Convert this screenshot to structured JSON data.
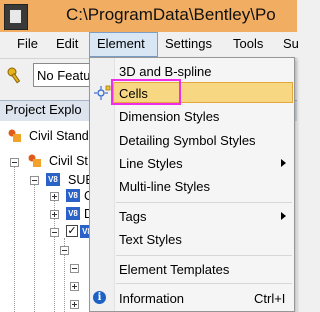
{
  "window": {
    "title": "C:\\ProgramData\\Bentley\\Po"
  },
  "menubar": [
    {
      "key": "file",
      "label": "File"
    },
    {
      "key": "edit",
      "label": "Edit"
    },
    {
      "key": "element",
      "label": "Element"
    },
    {
      "key": "settings",
      "label": "Settings"
    },
    {
      "key": "tools",
      "label": "Tools"
    },
    {
      "key": "su",
      "label": "Su"
    }
  ],
  "toolbar": {
    "feature_combo_value": "No Featu"
  },
  "explorer": {
    "title": "Project Explo",
    "nodes": [
      {
        "label": "Civil Stand"
      },
      {
        "label": "Civil St"
      },
      {
        "label": "SUE"
      },
      {
        "label": "C"
      },
      {
        "label": "D"
      },
      {
        "label": ""
      }
    ]
  },
  "element_menu": {
    "items": [
      {
        "key": "3d-and-bspline",
        "label": "3D and B-spline",
        "submenu": false
      },
      {
        "key": "cells",
        "label": "Cells",
        "submenu": false,
        "highlighted": true
      },
      {
        "key": "dimension-styles",
        "label": "Dimension Styles",
        "submenu": false
      },
      {
        "key": "detailing-symbol-styles",
        "label": "Detailing Symbol Styles",
        "submenu": false
      },
      {
        "key": "line-styles",
        "label": "Line Styles",
        "submenu": true
      },
      {
        "key": "multiline-styles",
        "label": "Multi-line Styles",
        "submenu": false
      },
      {
        "key": "tags",
        "label": "Tags",
        "submenu": true
      },
      {
        "key": "text-styles",
        "label": "Text Styles",
        "submenu": false
      },
      {
        "key": "element-templates",
        "label": "Element Templates",
        "submenu": false
      },
      {
        "key": "information",
        "label": "Information",
        "submenu": false,
        "shortcut": "Ctrl+I"
      }
    ]
  },
  "colors": {
    "titlebar": "#f1ad62",
    "highlight": "#f7d782",
    "annotation_box": "#ef2ee8",
    "v8_badge": "#2a62c8"
  },
  "icons": {
    "cells": "cells-icon",
    "information": "info-icon",
    "feature": "key-icon"
  }
}
